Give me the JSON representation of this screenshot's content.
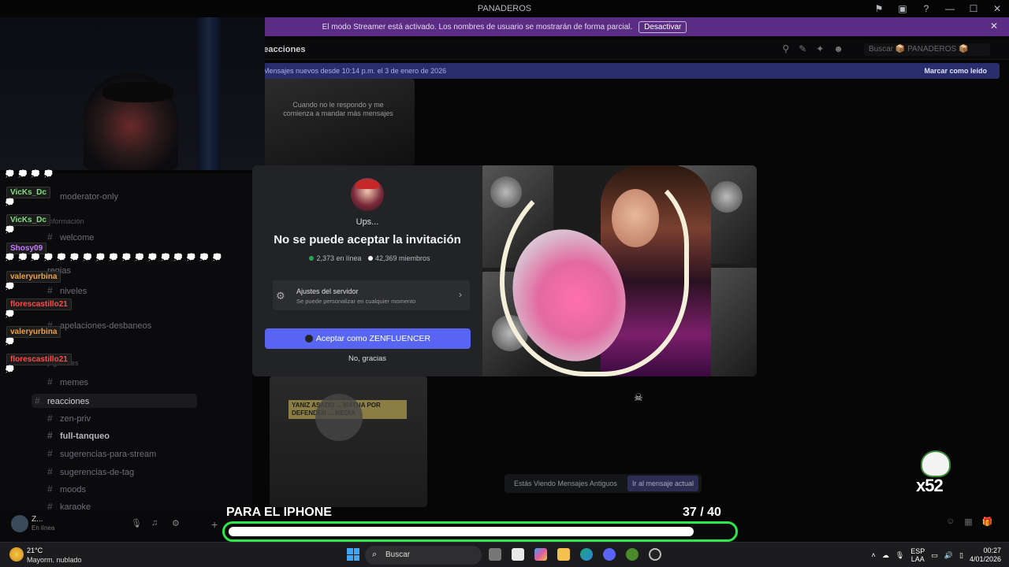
{
  "window": {
    "title": "PANADEROS",
    "controls": [
      "⚑",
      "▣",
      "?",
      "—",
      "☐",
      "✕"
    ]
  },
  "streamer_bar": {
    "message": "El modo Streamer está activado. Los nombres de usuario se mostrarán de forma parcial.",
    "button": "Desactivar",
    "close": "✕"
  },
  "channel_header": {
    "name": "reacciones",
    "search_placeholder": "Buscar 📦 PANADEROS 📦"
  },
  "new_messages_bar": {
    "text": "Mensajes nuevos desde 10:14 p.m. el 3 de enero de 2026",
    "mark_read": "Marcar como leído"
  },
  "media": {
    "thumb1_caption": "Cuando no le respondo y me comienza a mandar más mensajes",
    "thumb2_caption": "YANIZ ASADO ... MATNA POR DEFENDER ... MEDIA"
  },
  "sidebar": {
    "channels": [
      {
        "label": "moderator-only"
      },
      {
        "label": "información",
        "category": true
      },
      {
        "label": "welcome"
      },
      {
        "label": "regias"
      },
      {
        "label": "niveles"
      },
      {
        "label": "apelaciones-desbaneos"
      },
      {
        "label": "jugadores",
        "category": true
      },
      {
        "label": "memes"
      },
      {
        "label": "reacciones",
        "active": true
      },
      {
        "label": "zen-priv"
      },
      {
        "label": "full-tanqueo",
        "bold": true
      },
      {
        "label": "sugerencias-para-stream"
      },
      {
        "label": "sugerencias-de-tag"
      },
      {
        "label": "moods"
      },
      {
        "label": "karaoke"
      }
    ]
  },
  "user_panel": {
    "name": "Z...",
    "status": "En línea"
  },
  "chat_overlay": {
    "bubble": "💭",
    "users": [
      {
        "name": "VicKs_Dc",
        "color": "#7ee07e"
      },
      {
        "name": "VicKs_Dc",
        "color": "#7ee07e"
      },
      {
        "name": "Shosy09",
        "color": "#c77dff"
      },
      {
        "name": "valeryurbina",
        "color": "#f0a040"
      },
      {
        "name": "florescastillo21",
        "color": "#ff4a4a"
      },
      {
        "name": "valeryurbina",
        "color": "#f0a040"
      },
      {
        "name": "florescastillo21",
        "color": "#ff4a4a"
      }
    ]
  },
  "invite_modal": {
    "ups": "Ups...",
    "title": "No se puede aceptar la invitación",
    "online": "2,373 en línea",
    "members": "42,369 miembros",
    "online_color": "#23a55a",
    "members_color": "#ffffff",
    "settings_title": "Ajustes del servidor",
    "settings_subtitle": "Se puede personalizar en cualquier momento",
    "accept_button": "Aceptar como ZENFLUENCER",
    "decline_button": "No, gracias"
  },
  "jump_bar": {
    "text": "Estás Viendo Mensajes Antiguos",
    "button": "Ir al mensaje actual"
  },
  "overlay_logo": {
    "text": "x52"
  },
  "goal": {
    "label": "PARA EL IPHONE",
    "current": "37",
    "total": "/ 40",
    "progress": 0.925,
    "border_color": "#2ee84a"
  },
  "taskbar": {
    "weather_temp": "21°C",
    "weather_desc": "Mayorm. nublado",
    "search": "Buscar",
    "lang_top": "ESP",
    "lang_bottom": "LAA",
    "time": "00:27",
    "date": "4/01/2026"
  }
}
